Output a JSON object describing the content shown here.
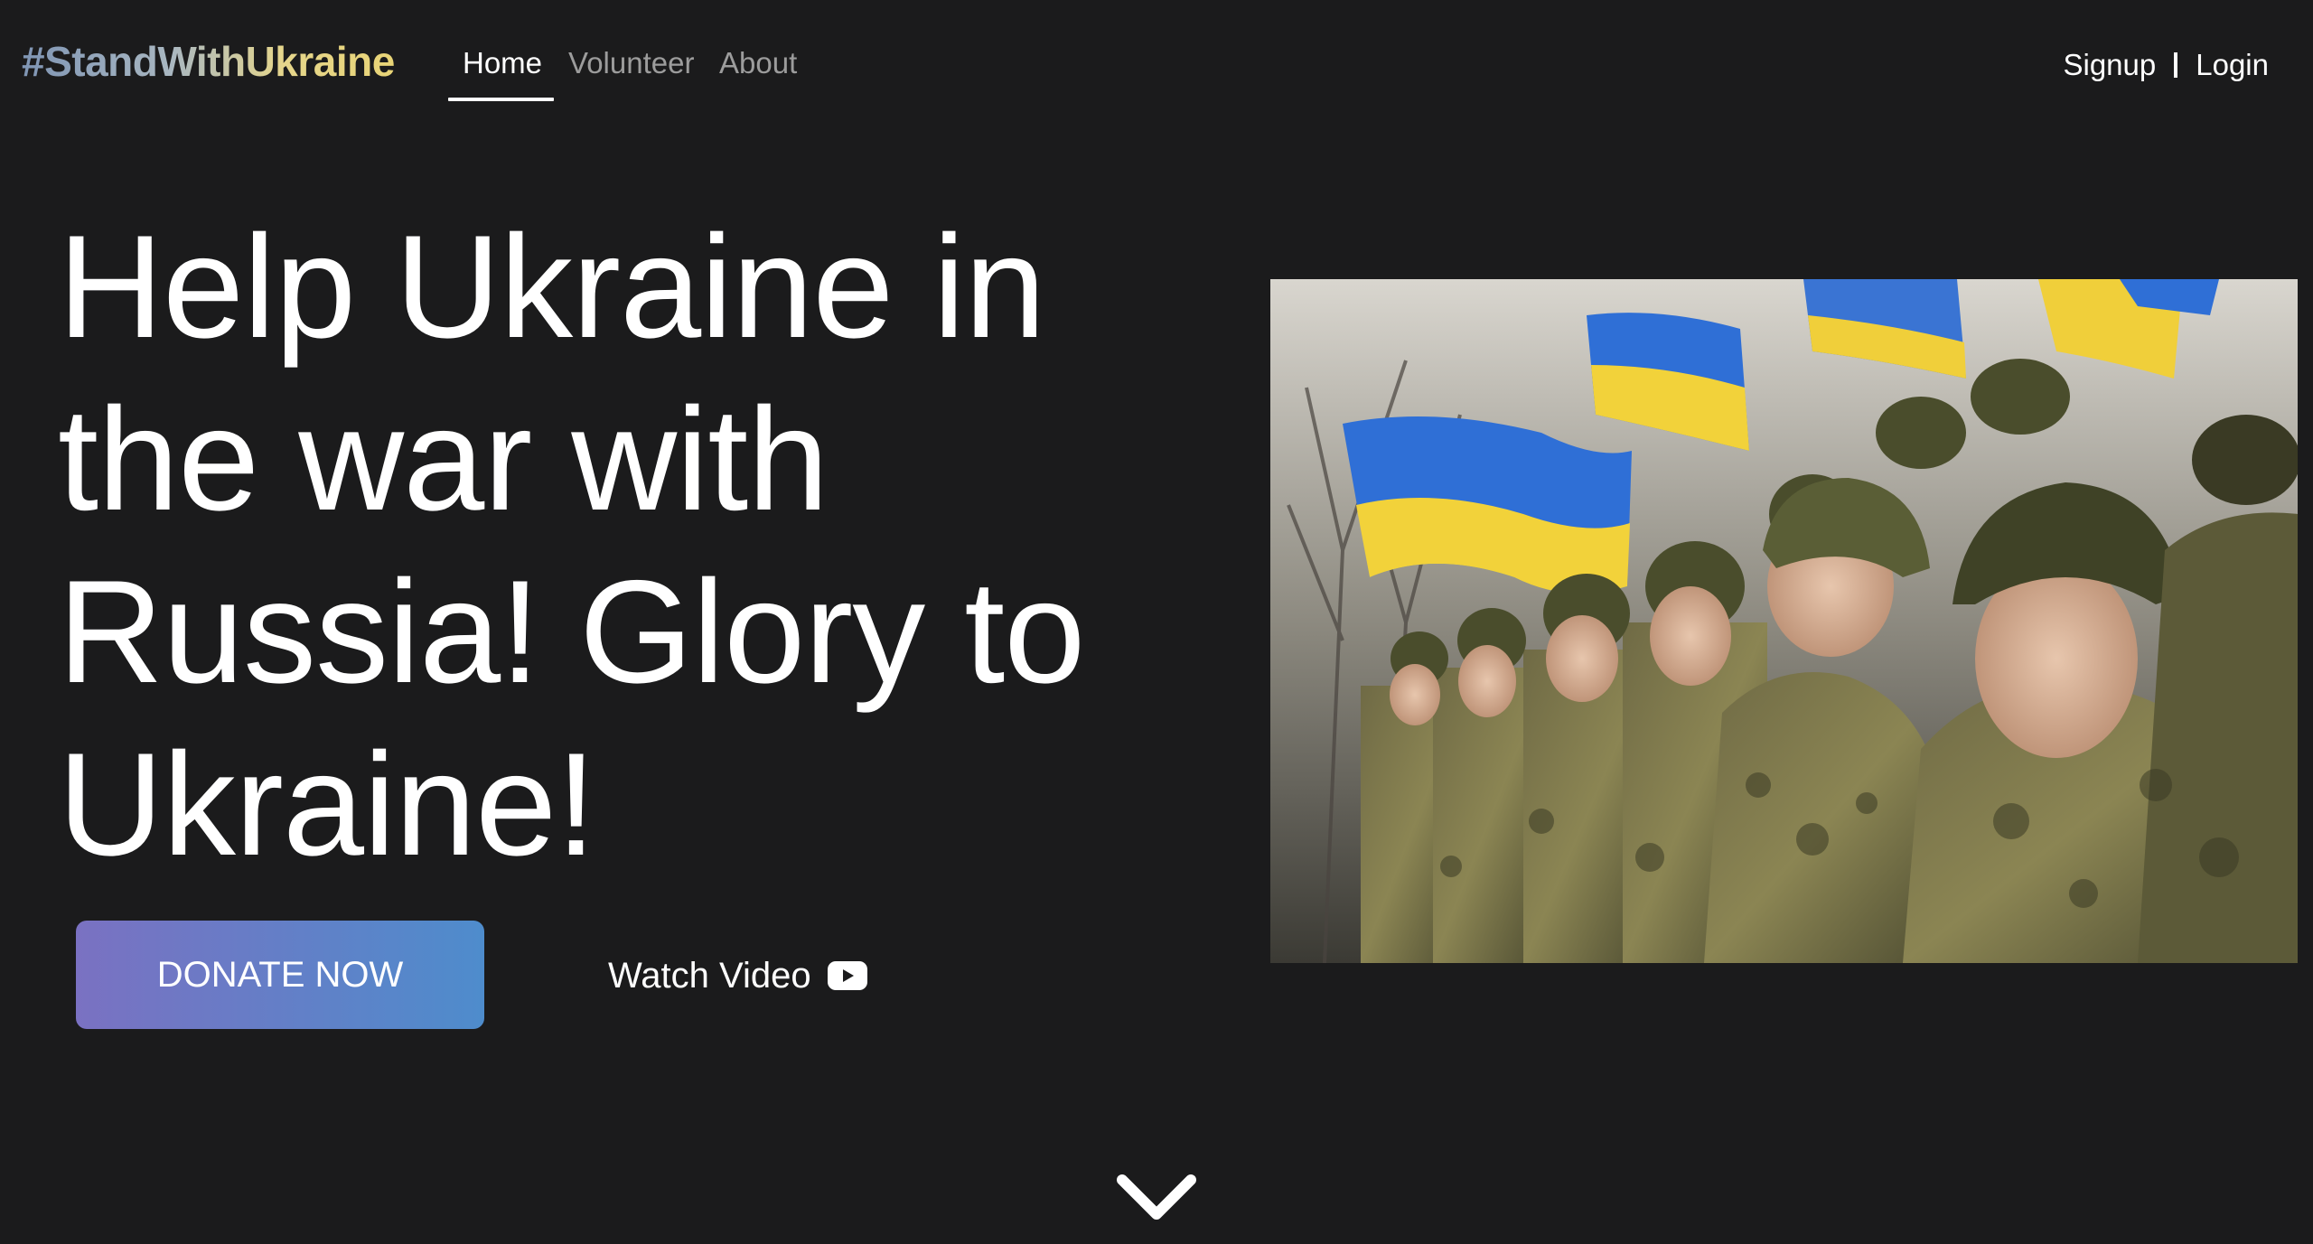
{
  "nav": {
    "logo": "#StandWithUkraine",
    "links": [
      {
        "label": "Home",
        "active": true
      },
      {
        "label": "Volunteer",
        "active": false
      },
      {
        "label": "About",
        "active": false
      }
    ],
    "signup": "Signup",
    "login": "Login"
  },
  "hero": {
    "headline": "Help Ukraine in the war with Russia! Glory to Ukraine!",
    "donate_label": "DONATE NOW",
    "watch_label": "Watch Video",
    "scroll_icon": "chevron-down-icon"
  },
  "colors": {
    "background": "#1b1b1c",
    "button_start": "#7a71c2",
    "button_end": "#4e8ccc",
    "flag_blue": "#2f6fd6",
    "flag_yellow": "#f2d23a"
  }
}
